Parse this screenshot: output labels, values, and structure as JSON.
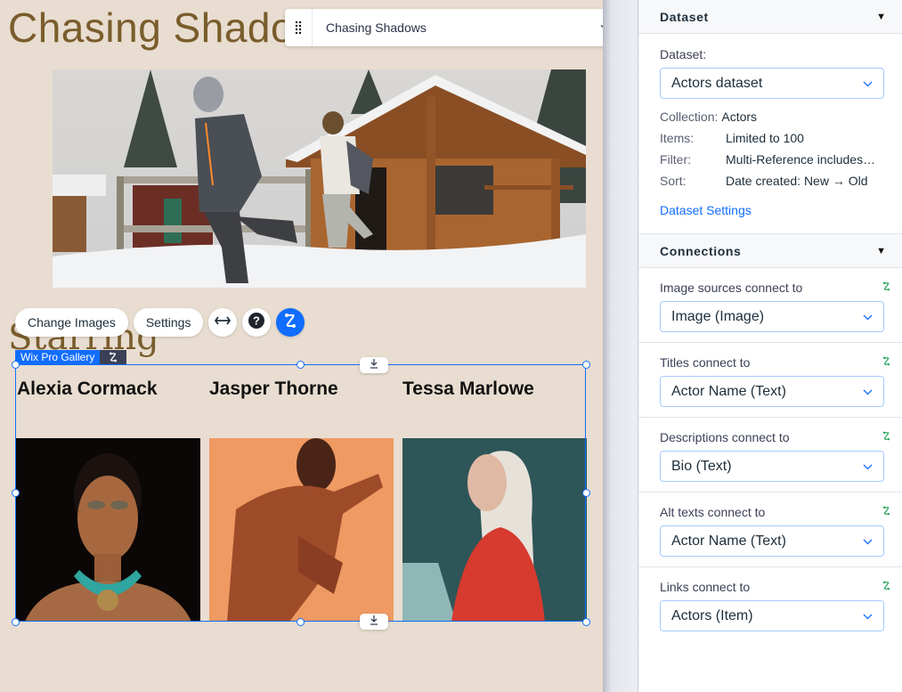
{
  "canvas": {
    "page_heading": "Chasing Shadows",
    "section_heading": "Starring",
    "page_selector": {
      "label": "Chasing Shadows"
    },
    "hero_image": {
      "alt": "Two people running in snow in front of a log cabin"
    },
    "toolbar": {
      "change_images_label": "Change Images",
      "settings_label": "Settings"
    },
    "gallery": {
      "tag_label": "Wix Pro Gallery",
      "items": [
        {
          "title": "Alexia Cormack",
          "photo": "Woman with gold eye makeup and turquoise necklace on black background"
        },
        {
          "title": "Jasper Thorne",
          "photo": "Shirtless man in dance pose on orange background"
        },
        {
          "title": "Tessa Marlowe",
          "photo": "Woman with long white hair in red shirt on teal background"
        }
      ]
    }
  },
  "panel": {
    "dataset_section": {
      "title": "Dataset",
      "dataset_label": "Dataset:",
      "dataset_value": "Actors dataset",
      "info": [
        {
          "key": "Collection:",
          "value": "Actors"
        },
        {
          "key": "Items:",
          "value": "Limited to 100"
        },
        {
          "key": "Filter:",
          "value": "Multi-Reference includes…"
        },
        {
          "key": "Sort:",
          "value": "Date created: New → Old"
        }
      ],
      "settings_link": "Dataset Settings"
    },
    "connections_section": {
      "title": "Connections",
      "fields": [
        {
          "label": "Image sources connect to",
          "value": "Image (Image)"
        },
        {
          "label": "Titles connect to",
          "value": "Actor Name (Text)"
        },
        {
          "label": "Descriptions connect to",
          "value": "Bio (Text)"
        },
        {
          "label": "Alt texts connect to",
          "value": "Actor Name (Text)"
        },
        {
          "label": "Links connect to",
          "value": "Actors (Item)"
        }
      ]
    }
  },
  "colors": {
    "accent": "#116dff",
    "heading_gold": "#7a5d2c",
    "canvas_bg": "#e8ddd0",
    "connected_green": "#25a55a"
  }
}
